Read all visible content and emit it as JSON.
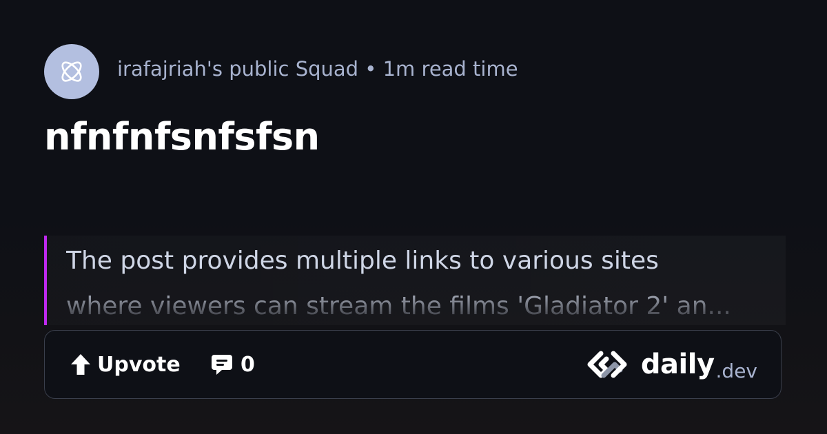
{
  "source": {
    "avatar_icon": "squad-atom-icon",
    "meta": "irafajriah's public Squad • 1m read time"
  },
  "post": {
    "title": "nfnfnfsnfsfsn",
    "summary_lines": [
      "The post provides multiple links to various sites",
      "where viewers can stream the films 'Gladiator 2' an..."
    ]
  },
  "actions": {
    "upvote_label": "Upvote",
    "upvote_icon": "arrow-up-icon",
    "comment_icon": "comment-icon",
    "comment_count": "0"
  },
  "brand": {
    "logo_icon": "daily-dev-logo-icon",
    "name": "daily",
    "tld": ".dev"
  },
  "colors": {
    "background": "#0e1016",
    "accent_border": "#c029f0",
    "avatar_bg": "#b3bfe0",
    "meta_text": "#a8b3cf"
  }
}
